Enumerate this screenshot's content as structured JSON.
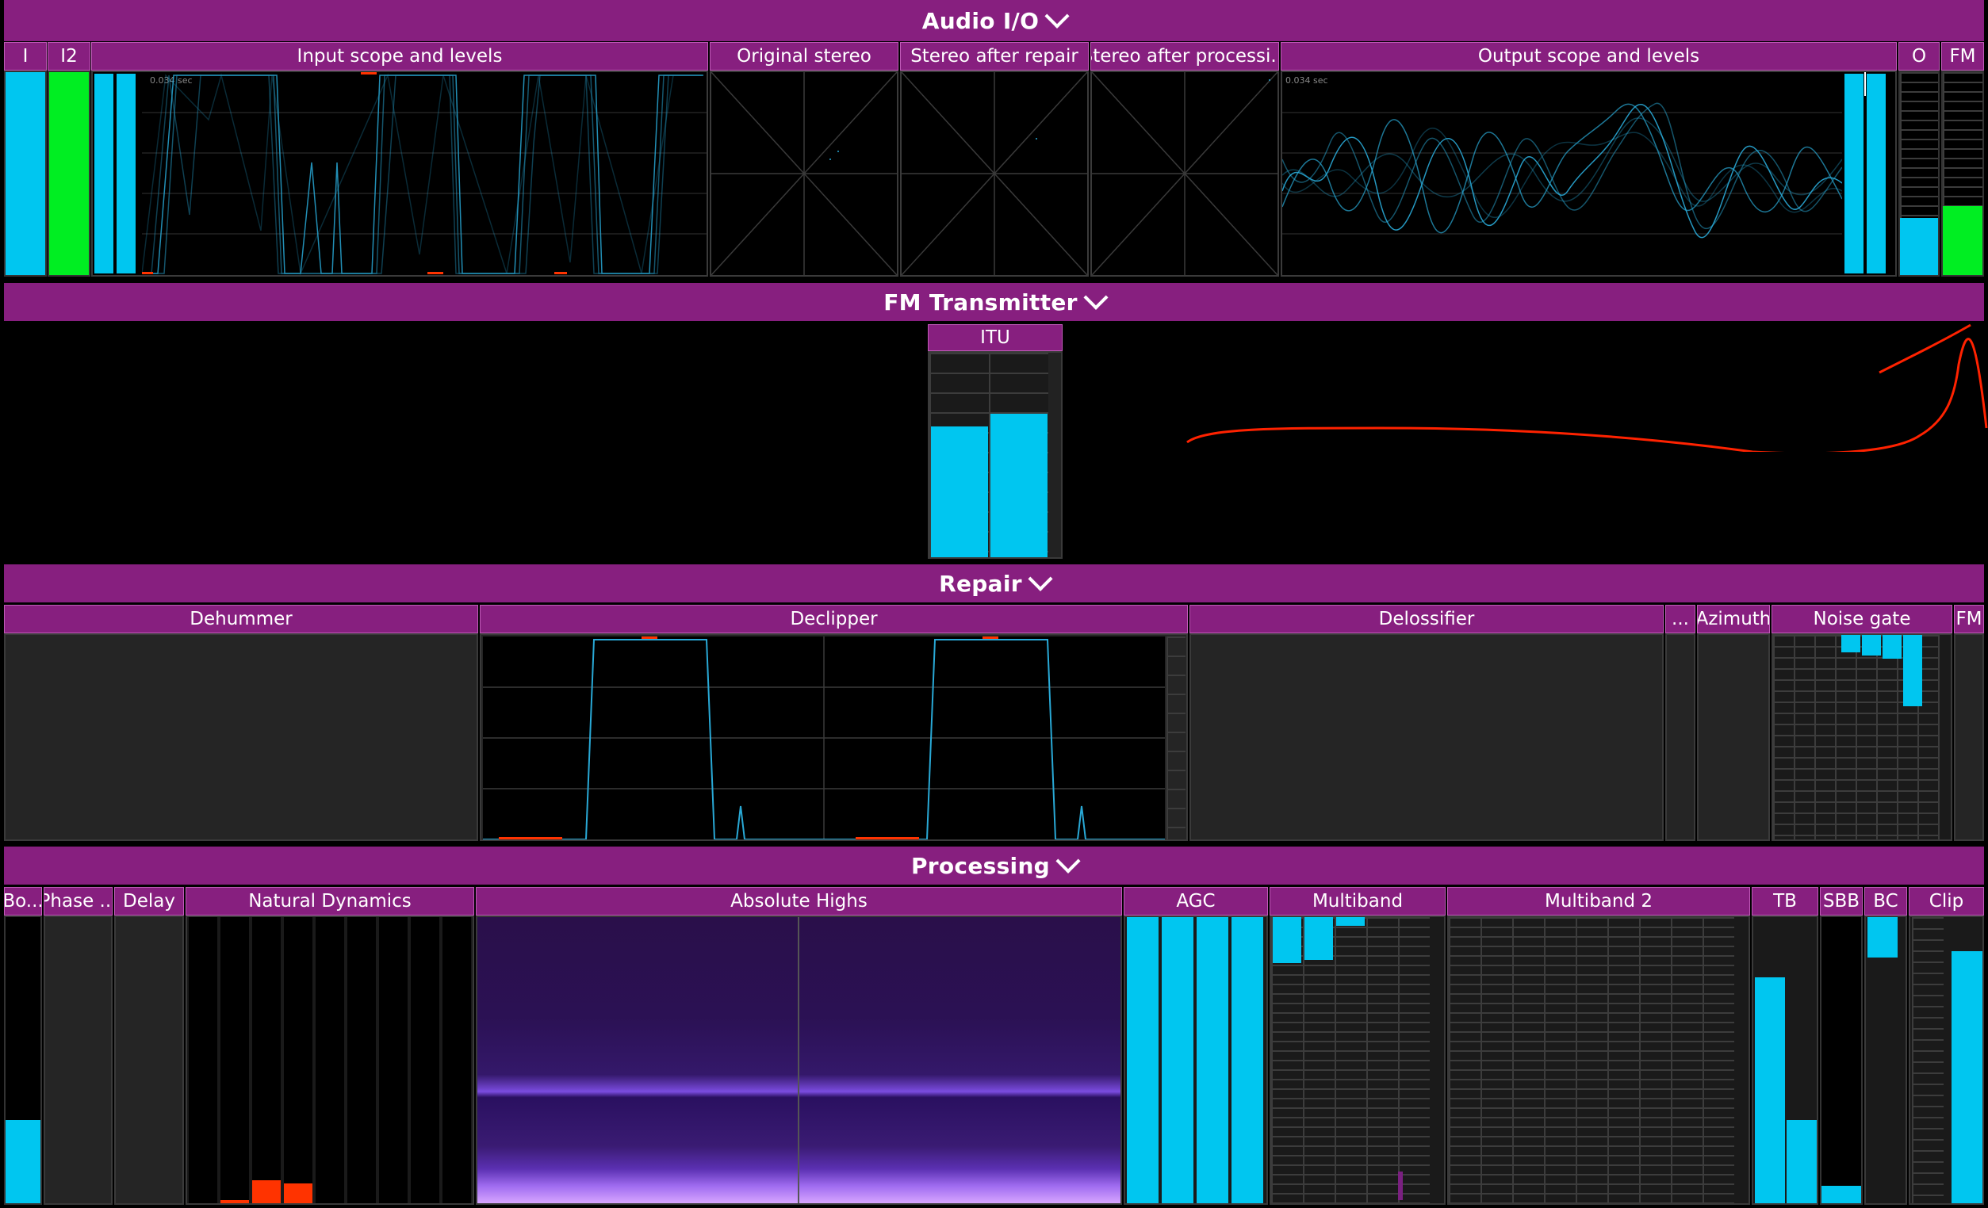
{
  "sections": {
    "audio_io": "Audio I/O",
    "fm_transmitter": "FM Transmitter",
    "repair": "Repair",
    "processing": "Processing"
  },
  "audio_io": {
    "headers": {
      "i": "I",
      "i2": "I2",
      "input_scope": "Input scope and levels",
      "original_stereo": "Original stereo",
      "stereo_after_repair": "Stereo after repair",
      "stereo_after_processing": "Stereo after processi...",
      "output_scope": "Output scope and levels",
      "o": "O",
      "fm": "FM"
    },
    "scope_time_label": "0.034 sec",
    "meters": {
      "i_level": 1.0,
      "i2_level": 1.0,
      "o_level": 0.28,
      "fm_level": 0.34
    }
  },
  "fm_transmitter": {
    "itu_label": "ITU",
    "itu_left": 0.64,
    "itu_right": 0.7
  },
  "repair": {
    "headers": {
      "dehummer": "Dehummer",
      "declipper": "Declipper",
      "delossifier": "Delossifier",
      "ellipsis": "...",
      "azimuth": "Azimuth",
      "noise_gate": "Noise gate",
      "fm": "FM"
    }
  },
  "processing": {
    "headers": {
      "bo": "Bo...",
      "phase": "Phase ...",
      "delay": "Delay",
      "natural_dynamics": "Natural Dynamics",
      "absolute_highs": "Absolute Highs",
      "agc": "AGC",
      "multiband": "Multiband",
      "multiband2": "Multiband 2",
      "tb": "TB",
      "sbb": "SBB",
      "bc": "BC",
      "clip": "Clip"
    },
    "levels": {
      "bo": 0.29,
      "natural_dynamics": [
        0.0,
        0.01,
        0.08,
        0.07,
        0.0,
        0.0,
        0.0,
        0.0,
        0.0
      ],
      "agc": [
        1.0,
        1.0,
        1.0,
        1.0
      ],
      "multiband_down": [
        0.16,
        0.15,
        0.03,
        0.0,
        0.0
      ],
      "multiband2_down": [
        0.0,
        0.0,
        0.0,
        0.0,
        0.0,
        0.0,
        0.0,
        0.0,
        0.0
      ],
      "tb": [
        0.79,
        0.29
      ],
      "sbb": 0.06,
      "bc_down": 0.14,
      "clip": [
        0.0,
        0.88
      ]
    }
  },
  "colors": {
    "section_header": "#871f7f",
    "meter_cyan": "#00c6f0",
    "meter_green": "#00ee22",
    "annotation_red": "#ff2200",
    "scope_trace": "#29a9d6"
  }
}
